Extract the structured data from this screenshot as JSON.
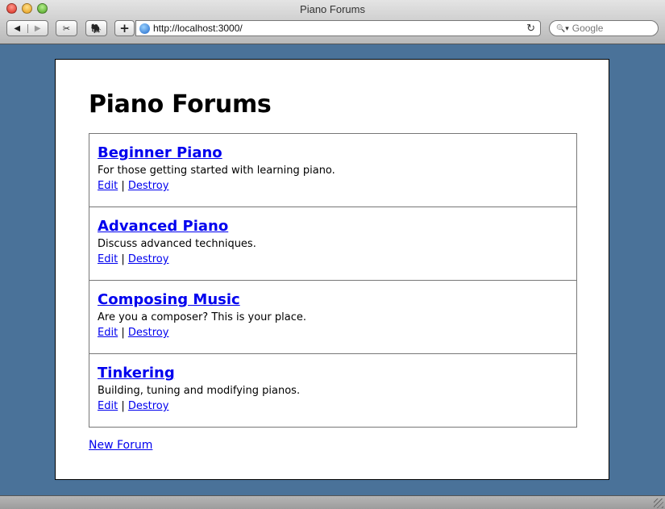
{
  "window": {
    "title": "Piano Forums"
  },
  "toolbar": {
    "back_icon": "back-arrow-icon",
    "forward_icon": "forward-arrow-icon",
    "back_glyph": "◀",
    "forward_glyph": "▶",
    "snip_glyph": "✂",
    "evernote_glyph": "🐘",
    "add_glyph": "+",
    "url": "http://localhost:3000/",
    "reload_glyph": "↻",
    "search_placeholder": "Google",
    "search_glyph": "🔍▾"
  },
  "page": {
    "heading": "Piano Forums",
    "forums": [
      {
        "name": "Beginner Piano",
        "description": "For those getting started with learning piano.",
        "edit": "Edit",
        "separator": "|",
        "destroy": "Destroy"
      },
      {
        "name": "Advanced Piano",
        "description": "Discuss advanced techniques.",
        "edit": "Edit",
        "separator": "|",
        "destroy": "Destroy"
      },
      {
        "name": "Composing Music",
        "description": "Are you a composer? This is your place.",
        "edit": "Edit",
        "separator": "|",
        "destroy": "Destroy"
      },
      {
        "name": "Tinkering",
        "description": "Building, tuning and modifying pianos.",
        "edit": "Edit",
        "separator": "|",
        "destroy": "Destroy"
      }
    ],
    "new_forum": "New Forum"
  },
  "colors": {
    "desktop": "#4a7299",
    "link": "#0000ee"
  }
}
